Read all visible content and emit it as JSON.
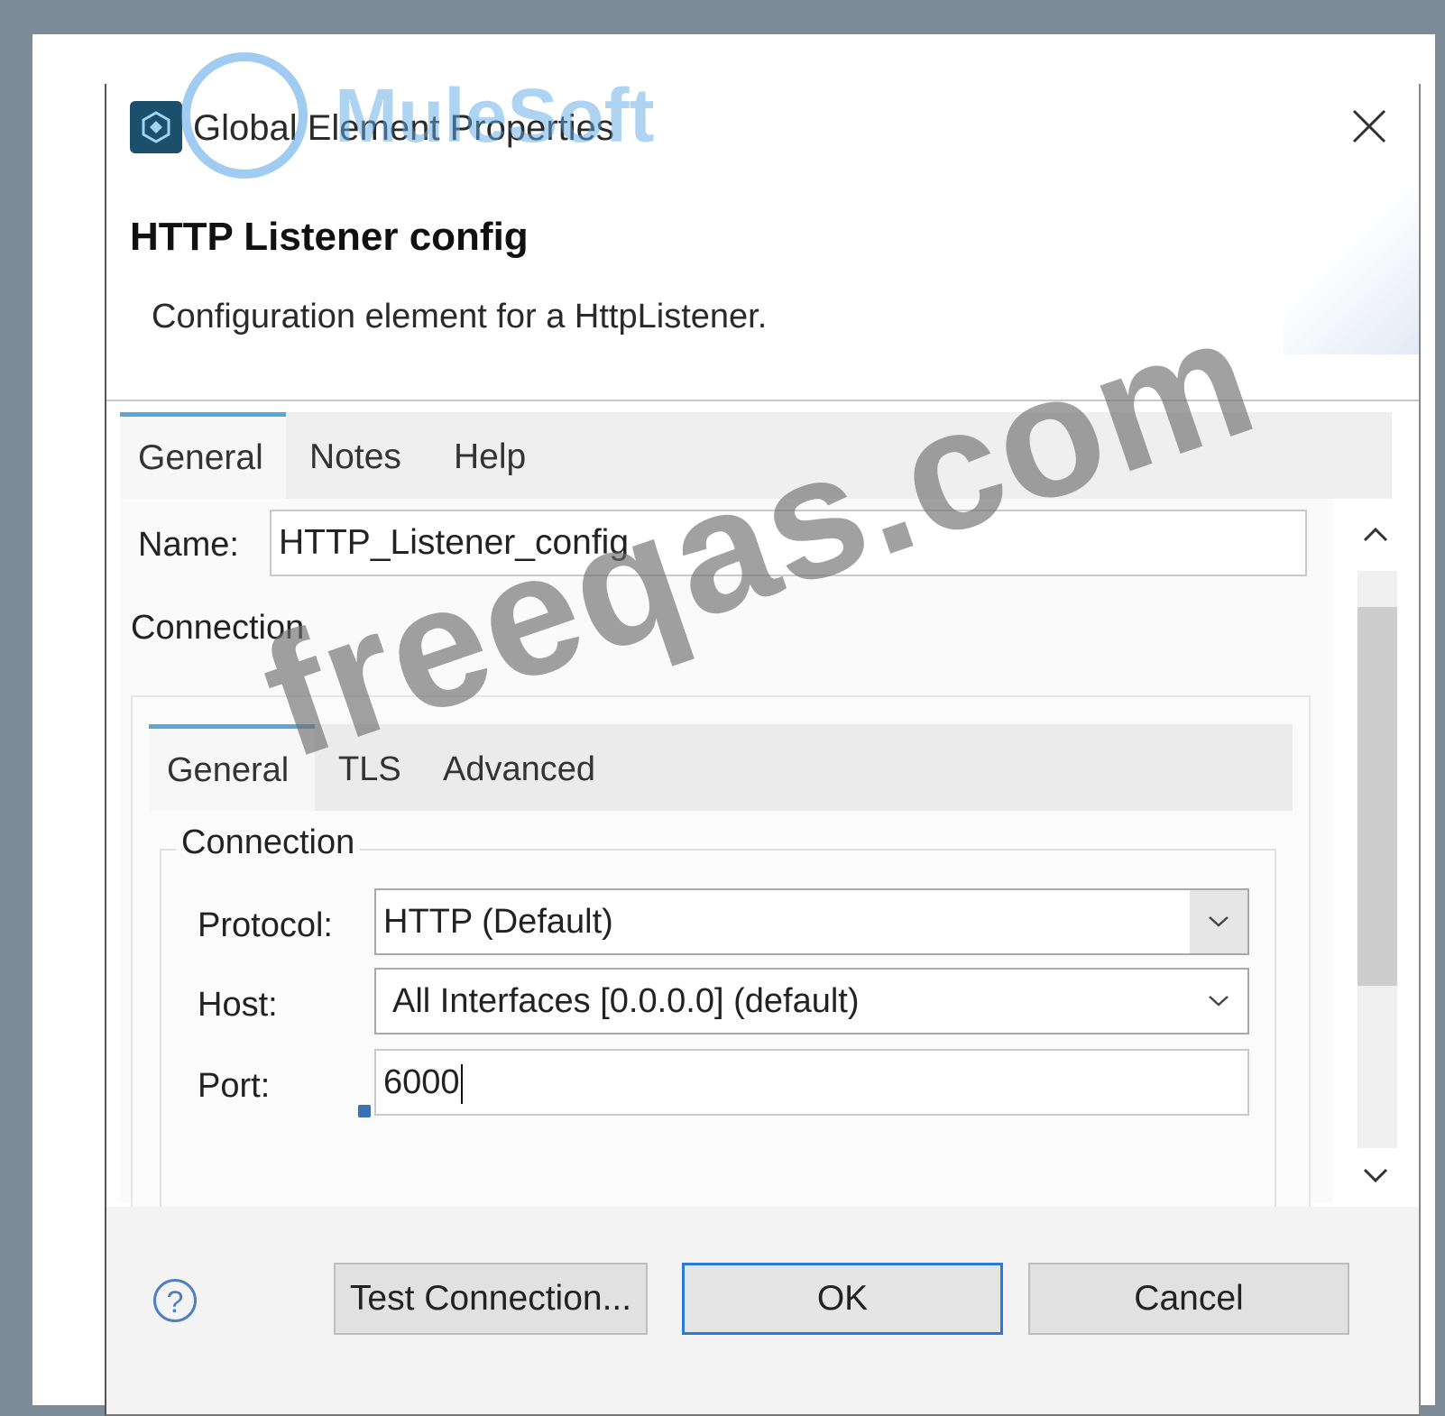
{
  "window": {
    "title": "Global Element Properties",
    "close_icon": "close-icon"
  },
  "header": {
    "title": "HTTP Listener config",
    "description": "Configuration element for a HttpListener."
  },
  "outer_tabs": [
    {
      "label": "General",
      "active": true
    },
    {
      "label": "Notes",
      "active": false
    },
    {
      "label": "Help",
      "active": false
    }
  ],
  "name_field": {
    "label": "Name:",
    "value": "HTTP_Listener_config"
  },
  "connection_section": {
    "label": "Connection",
    "tabs": [
      {
        "label": "General",
        "active": true
      },
      {
        "label": "TLS",
        "active": false
      },
      {
        "label": "Advanced",
        "active": false
      }
    ],
    "group_label": "Connection",
    "protocol": {
      "label": "Protocol:",
      "value": "HTTP (Default)"
    },
    "host": {
      "label": "Host:",
      "value": "All Interfaces [0.0.0.0] (default)"
    },
    "port": {
      "label": "Port:",
      "value": "6000"
    }
  },
  "footer": {
    "help_icon": "?",
    "test_connection_label": "Test Connection...",
    "ok_label": "OK",
    "cancel_label": "Cancel"
  },
  "watermarks": {
    "brand": "MuleSoft",
    "site": "freeqas.com"
  },
  "colors": {
    "accent_tab": "#5aa7d6",
    "ok_border": "#2a7bd4",
    "outer_frame": "#7d8b99"
  }
}
